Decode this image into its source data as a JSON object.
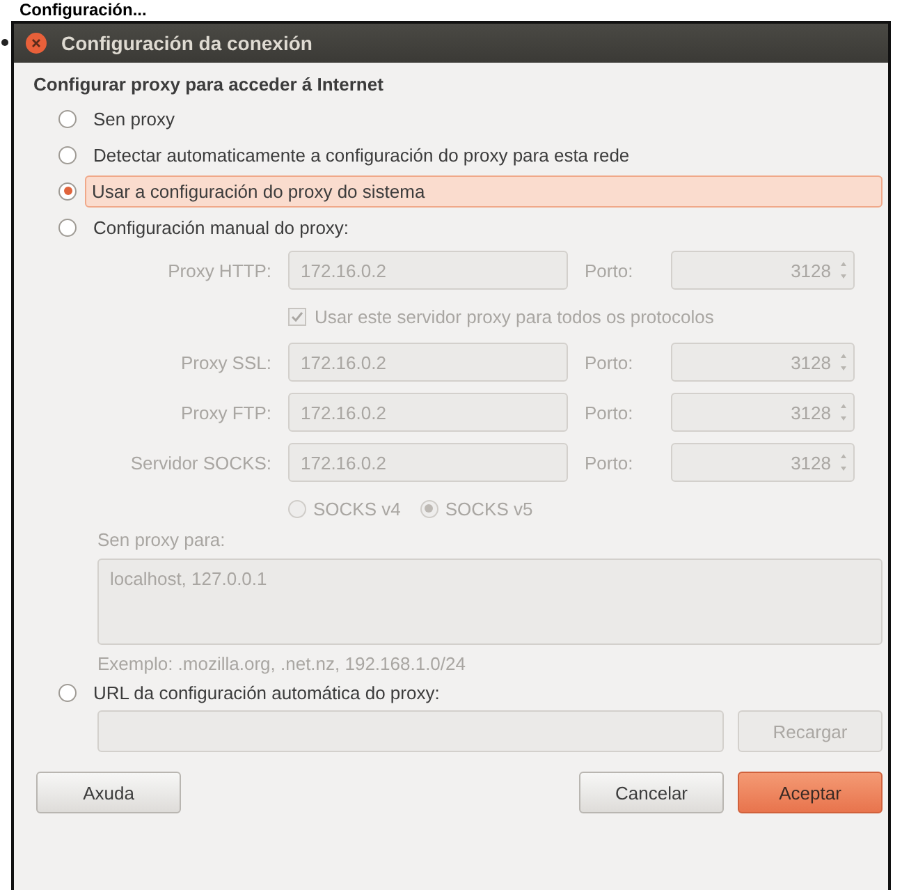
{
  "caption": "Configuración...",
  "window": {
    "title": "Configuración da conexión"
  },
  "heading": "Configurar proxy para acceder á Internet",
  "proxy_modes": [
    {
      "label": "Sen proxy",
      "selected": false
    },
    {
      "label": "Detectar automaticamente a configuración do proxy para esta rede",
      "selected": false
    },
    {
      "label": "Usar a configuración do proxy do sistema",
      "selected": true
    },
    {
      "label": "Configuración manual do proxy:",
      "selected": false
    }
  ],
  "manual": {
    "disabled": true,
    "rows": [
      {
        "label": "Proxy HTTP:",
        "value": "172.16.0.2",
        "port_label": "Porto:",
        "port": "3128"
      },
      {
        "label": "Proxy SSL:",
        "value": "172.16.0.2",
        "port_label": "Porto:",
        "port": "3128"
      },
      {
        "label": "Proxy FTP:",
        "value": "172.16.0.2",
        "port_label": "Porto:",
        "port": "3128"
      },
      {
        "label": "Servidor SOCKS:",
        "value": "172.16.0.2",
        "port_label": "Porto:",
        "port": "3128"
      }
    ],
    "share_all": {
      "label": "Usar este servidor proxy para todos os protocolos",
      "checked": true
    },
    "socks_versions": [
      {
        "label": "SOCKS v4",
        "selected": false
      },
      {
        "label": "SOCKS v5",
        "selected": true
      }
    ],
    "no_proxy_label": "Sen proxy para:",
    "no_proxy_value": "localhost, 127.0.0.1",
    "example": "Exemplo: .mozilla.org, .net.nz, 192.168.1.0/24"
  },
  "auto_url": {
    "label": "URL da configuración automática do proxy:",
    "selected": false,
    "reload_button": {
      "label": "Recargar",
      "disabled": true
    }
  },
  "buttons": [
    {
      "label": "Axuda",
      "default": false
    },
    {
      "label": "Cancelar",
      "default": false
    },
    {
      "label": "Aceptar",
      "default": true
    }
  ]
}
